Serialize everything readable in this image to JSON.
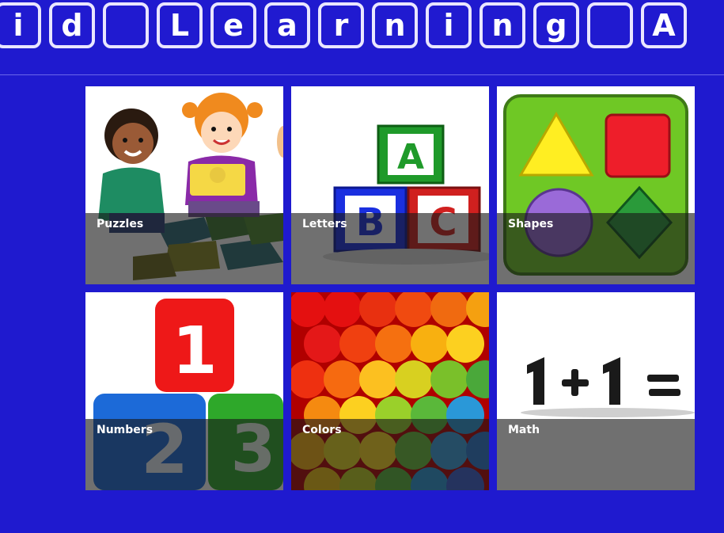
{
  "header": {
    "title_letters": [
      "i",
      "d",
      " ",
      "L",
      "e",
      "a",
      "r",
      "n",
      "i",
      "n",
      "g",
      " ",
      "A"
    ]
  },
  "tiles": [
    {
      "label": "Puzzles"
    },
    {
      "label": "Letters"
    },
    {
      "label": "Shapes"
    },
    {
      "label": "Numbers"
    },
    {
      "label": "Colors"
    },
    {
      "label": "Math"
    }
  ],
  "colors": {
    "background": "#1f1acf",
    "tile_border": "#e9e6ff"
  },
  "icons": {
    "puzzles": "kids-puzzle-illustration",
    "letters": "abc-blocks-illustration",
    "shapes": "shapes-board-illustration",
    "numbers": "number-blocks-illustration",
    "colors": "colored-balls-illustration",
    "math": "math-equation-illustration"
  }
}
